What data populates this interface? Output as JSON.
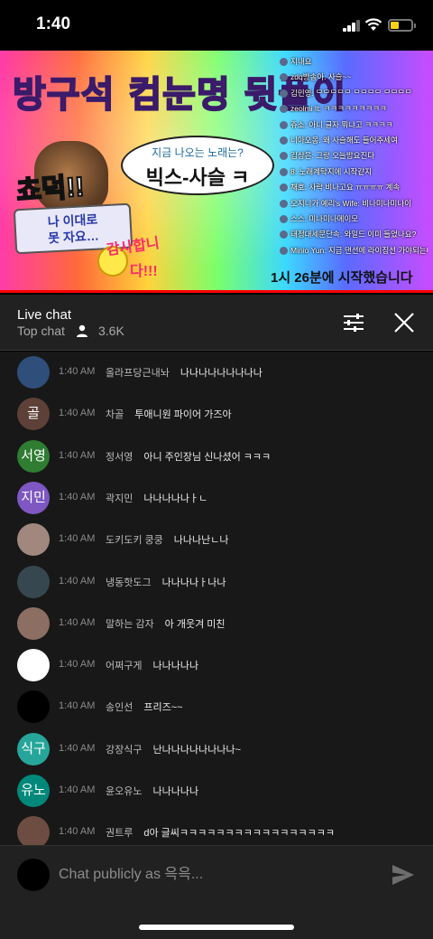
{
  "status_bar": {
    "time": "1:40"
  },
  "video": {
    "title": "방구석 컴눈명 뒷풀이",
    "bubble_question": "지금 나오는 노래는?",
    "bubble_answer": "빅스-사슬 ㅋ",
    "shout": "쵸덕!!",
    "scroll_text": [
      "나 이대로",
      "못 자요…"
    ],
    "thanks": [
      "감사합니",
      "다!!!"
    ],
    "start_text": "1시 26분에 시작했습니다",
    "overlay_chat": [
      "지내요",
      "zdq방송아: 사슬~~",
      "김민영: ᄆᄆᄆᄆᄆ ᄆᄆᄆᄆ ᄆᄆᄆᄆ",
      "zeolmi It: ㅋㅋㅋㅋㅋㅋㅋㅋㅋ",
      "쥬소: 아니 글자 뭐냐고 ㅋㅋㅋㅋ",
      "니아오옹: 왜 사슬해도 들어주세여",
      "김상은: 그랑 오늘밤요진다",
      "8: 노래계탁지에 시작같지",
      "채호: 사락 비나고요 ㅠㅠㅠㅠ 계속",
      "오지니가 예리's Wife: 비나미나미나이",
      "스스: 미나미나메이모",
      "태정대세문단속: 와일드 이미 들었나요?",
      "Minio Yun: 지금 댄션에 라이징선 가야되는데"
    ]
  },
  "chat_header": {
    "title": "Live chat",
    "mode": "Top chat",
    "viewers": "3.6K"
  },
  "messages": [
    {
      "avatar_text": "",
      "avatar_color": "#2f4f7a",
      "time": "1:40 AM",
      "author": "올라프당근내놔",
      "text": "나나나나나나나나나"
    },
    {
      "avatar_text": "골",
      "avatar_color": "#5d4037",
      "time": "1:40 AM",
      "author": "차골",
      "text": "투애니원 파이어 가즈아"
    },
    {
      "avatar_text": "서영",
      "avatar_color": "#2e7d32",
      "time": "1:40 AM",
      "author": "정서영",
      "text": "아니 주인장님 신나셨어 ㅋㅋㅋ"
    },
    {
      "avatar_text": "지민",
      "avatar_color": "#7e57c2",
      "time": "1:40 AM",
      "author": "곽지민",
      "text": "나나나나나ㅏㄴ"
    },
    {
      "avatar_text": "",
      "avatar_color": "#a1887f",
      "time": "1:40 AM",
      "author": "도키도키 쿵쿵",
      "text": "나나나난ㄴ나"
    },
    {
      "avatar_text": "",
      "avatar_color": "#37474f",
      "time": "1:40 AM",
      "author": "냉동핫도그",
      "text": "나나나나ㅏ나나"
    },
    {
      "avatar_text": "",
      "avatar_color": "#8d6e63",
      "time": "1:40 AM",
      "author": "말하는 감자",
      "text": "아 개웃겨 미친"
    },
    {
      "avatar_text": "",
      "avatar_color": "#ffffff",
      "time": "1:40 AM",
      "author": "어쩌구게",
      "text": "나나나나나"
    },
    {
      "avatar_text": "",
      "avatar_color": "#000000",
      "time": "1:40 AM",
      "author": "송인선",
      "text": "프리즈~~"
    },
    {
      "avatar_text": "식구",
      "avatar_color": "#26a69a",
      "time": "1:40 AM",
      "author": "강장식구",
      "text": "난나나나나나나나나~"
    },
    {
      "avatar_text": "유노",
      "avatar_color": "#00897b",
      "time": "1:40 AM",
      "author": "윤오유노",
      "text": "나나나나나"
    },
    {
      "avatar_text": "",
      "avatar_color": "#6d4c41",
      "time": "1:40 AM",
      "author": "권트루",
      "text": "d아 글씨ㅋㅋㅋㅋㅋㅋㅋㅋㅋㅋㅋㅋㅋㅋㅋㅋㅋ"
    }
  ],
  "input": {
    "placeholder": "Chat publicly as 윽윽..."
  },
  "icons": {
    "viewer": "person-icon",
    "filter": "tune-icon",
    "close": "close-icon",
    "send": "send-icon"
  }
}
